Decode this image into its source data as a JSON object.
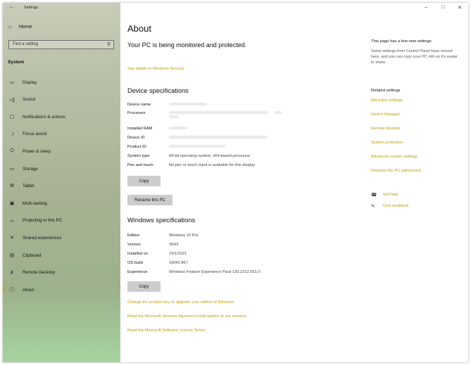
{
  "window": {
    "app_title": "Settings",
    "back_glyph": "←",
    "minimize": "–",
    "maximize": "□",
    "close": "✕"
  },
  "sidebar": {
    "home": "Home",
    "search_placeholder": "Find a setting",
    "section": "System",
    "items": [
      {
        "label": "Display",
        "icon": "display-icon",
        "glyph": "▭"
      },
      {
        "label": "Sound",
        "icon": "sound-icon",
        "glyph": "◁)"
      },
      {
        "label": "Notifications & actions",
        "icon": "notifications-icon",
        "glyph": "▢"
      },
      {
        "label": "Focus assist",
        "icon": "focus-assist-icon",
        "glyph": "☽"
      },
      {
        "label": "Power & sleep",
        "icon": "power-icon",
        "glyph": "⏻"
      },
      {
        "label": "Storage",
        "icon": "storage-icon",
        "glyph": "▭"
      },
      {
        "label": "Tablet",
        "icon": "tablet-icon",
        "glyph": "⧉"
      },
      {
        "label": "Multi-tasking",
        "icon": "multitasking-icon",
        "glyph": "▣"
      },
      {
        "label": "Projecting to this PC",
        "icon": "projecting-icon",
        "glyph": "▱"
      },
      {
        "label": "Shared experiences",
        "icon": "shared-experiences-icon",
        "glyph": "✕"
      },
      {
        "label": "Clipboard",
        "icon": "clipboard-icon",
        "glyph": "▤"
      },
      {
        "label": "Remote Desktop",
        "icon": "remote-desktop-icon",
        "glyph": "✗"
      },
      {
        "label": "About",
        "icon": "info-icon",
        "glyph": "ⓘ"
      }
    ]
  },
  "main": {
    "title": "About",
    "monitored": "Your PC is being monitored and protected.",
    "security_link": "See details in Windows Security",
    "device_specs": {
      "heading": "Device specifications",
      "rows": [
        {
          "label": "Device name",
          "value": ""
        },
        {
          "label": "Processor",
          "value": ""
        },
        {
          "label": "Installed RAM",
          "value": ""
        },
        {
          "label": "Device ID",
          "value": ""
        },
        {
          "label": "Product ID",
          "value": ""
        },
        {
          "label": "System type",
          "value": "64-bit operating system, x64-based processor"
        },
        {
          "label": "Pen and touch",
          "value": "No pen or touch input is available for this display"
        }
      ],
      "copy_label": "Copy",
      "rename_label": "Rename this PC"
    },
    "windows_specs": {
      "heading": "Windows specifications",
      "rows": [
        {
          "label": "Edition",
          "value": "Windows 10 Pro"
        },
        {
          "label": "Version",
          "value": "20H2"
        },
        {
          "label": "Installed on",
          "value": "19/1/2021"
        },
        {
          "label": "OS build",
          "value": "19042.867"
        },
        {
          "label": "Experience",
          "value": "Windows Feature Experience Pack 120.2212.551.0"
        }
      ],
      "copy_label": "Copy"
    },
    "links": [
      "Change the product key or upgrade your edition of Windows",
      "Read the Microsoft Services Agreement that applies to our services",
      "Read the Microsoft Software Licence Terms"
    ]
  },
  "right_panel": {
    "notice_heading": "This page has a few new settings",
    "notice_text": "Some settings from Control Panel have moved here, and you can copy your PC info so it's easier to share.",
    "related_heading": "Related settings",
    "related_links": [
      "BitLocker settings",
      "Device Manager",
      "Remote desktop",
      "System protection",
      "Advanced system settings",
      "Rename this PC (advanced)"
    ],
    "get_help": "Get help",
    "give_feedback": "Give feedback"
  },
  "colors": {
    "accent_link": "#c09a00",
    "button_bg": "#cccccc"
  }
}
